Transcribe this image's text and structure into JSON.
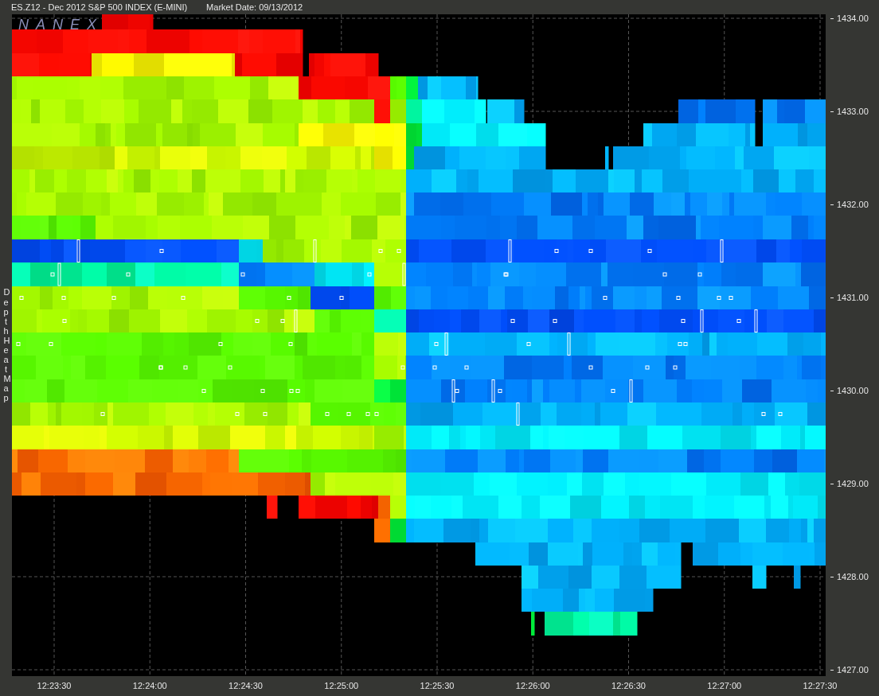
{
  "header": {
    "symbol": "ES.Z12 - Dec 2012 S&P 500 INDEX (E-MINI)",
    "market_date": "Market Date: 09/13/2012"
  },
  "chart": {
    "logo": "NANEX",
    "side_label": "Depth Heat Map",
    "y_ticks": [
      "1434.00",
      "1433.00",
      "1432.00",
      "1431.00",
      "1430.00",
      "1429.00",
      "1428.00",
      "1427.00"
    ],
    "x_ticks": [
      "12:23:30",
      "12:24:00",
      "12:24:30",
      "12:25:00",
      "12:25:30",
      "12:26:00",
      "12:26:30",
      "12:27:00",
      "12:27:30"
    ]
  }
}
